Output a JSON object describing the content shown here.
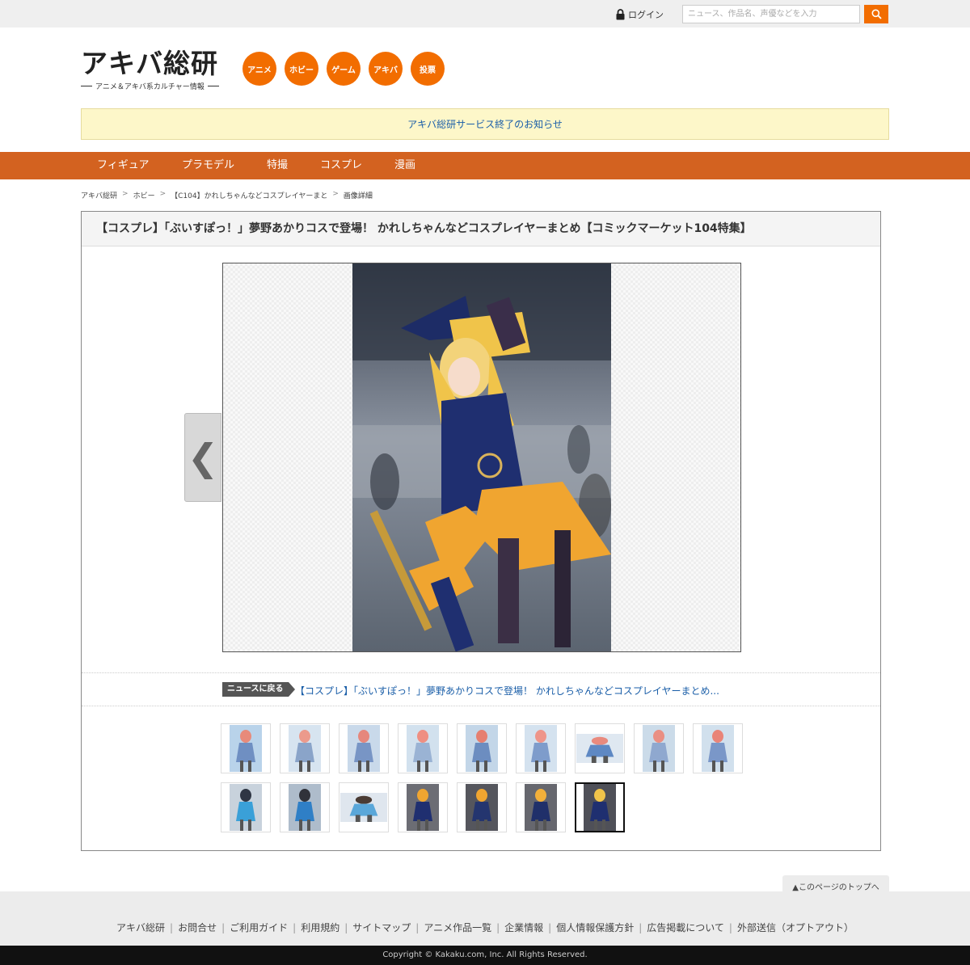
{
  "topbar": {
    "login_label": "ログイン",
    "search_placeholder": "ニュース、作品名、声優などを入力"
  },
  "header": {
    "logo_text": "アキバ総研",
    "logo_tagline": "アニメ＆アキバ系カルチャー情報",
    "category_circles": [
      "アニメ",
      "ホビー",
      "ゲーム",
      "アキバ",
      "投票"
    ],
    "accent_color": "#f26d00"
  },
  "notice": {
    "text": "アキバ総研サービス終了のお知らせ"
  },
  "global_nav": {
    "items": [
      "フィギュア",
      "プラモデル",
      "特撮",
      "コスプレ",
      "漫画"
    ],
    "bar_color": "#d36220"
  },
  "breadcrumb": {
    "items": [
      "アキバ総研",
      "ホビー",
      "【C104】かれしちゃんなどコスプレイヤーまと",
      "画像詳細"
    ],
    "separator": ">"
  },
  "article": {
    "title": "【コスプレ】「ぶいすぽっ！」夢野あかりコスで登場！ かれしちゃんなどコスプレイヤーまとめ【コミックマーケット104特集】",
    "prev_arrow": "❮",
    "back_label": "ニュースに戻る",
    "news_link": "【コスプレ】「ぶいすぽっ！」夢野あかりコスで登場！ かれしちゃんなどコスプレイヤーまとめ..."
  },
  "thumbnails": {
    "count": 16,
    "selected_index": 15
  },
  "footer": {
    "to_top": "▲このページのトップへ",
    "links": [
      "アキバ総研",
      "お問合せ",
      "ご利用ガイド",
      "利用規約",
      "サイトマップ",
      "アニメ作品一覧",
      "企業情報",
      "個人情報保護方針",
      "広告掲載について",
      "外部送信（オプトアウト）"
    ],
    "copyright": "Copyright © Kakaku.com, Inc. All Rights Reserved."
  }
}
